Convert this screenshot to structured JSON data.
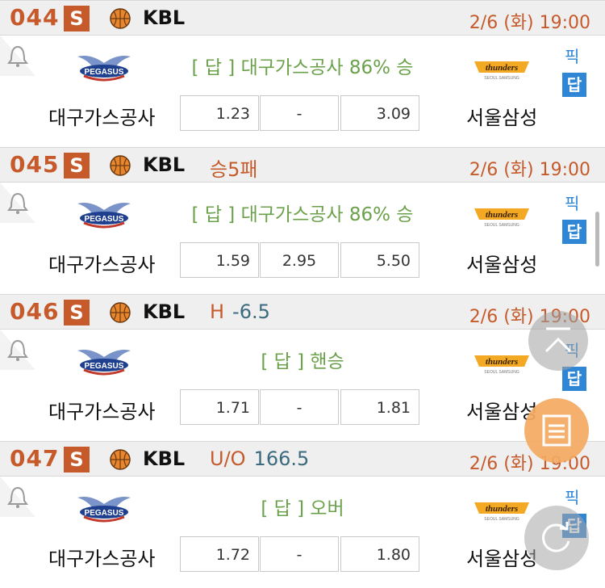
{
  "games": [
    {
      "number": "044",
      "badge": "S",
      "league": "KBL",
      "extra_key": "",
      "extra_value": "",
      "extra_style": "",
      "date": "2/6 (화)  19:00",
      "answer": "[ 답 ]  대구가스공사 86% 승",
      "home_team": "대구가스공사",
      "away_team": "서울삼성",
      "odds": [
        "1.23",
        "-",
        "3.09"
      ],
      "pick_label": "픽",
      "answer_badge": "답"
    },
    {
      "number": "045",
      "badge": "S",
      "league": "KBL",
      "extra_key": "승5패",
      "extra_value": "",
      "extra_style": "",
      "date": "2/6 (화)  19:00",
      "answer": "[ 답 ]  대구가스공사 86% 승",
      "home_team": "대구가스공사",
      "away_team": "서울삼성",
      "odds": [
        "1.59",
        "2.95",
        "5.50"
      ],
      "pick_label": "픽",
      "answer_badge": "답"
    },
    {
      "number": "046",
      "badge": "S",
      "league": "KBL",
      "extra_key": "H",
      "extra_value": "-6.5",
      "extra_style": "",
      "date": "2/6 (화)  19:00",
      "answer": "[ 답 ] 핸승",
      "home_team": "대구가스공사",
      "away_team": "서울삼성",
      "odds": [
        "1.71",
        "-",
        "1.81"
      ],
      "pick_label": "픽",
      "answer_badge": "답"
    },
    {
      "number": "047",
      "badge": "S",
      "league": "KBL",
      "extra_key": "U/O",
      "extra_value": "166.5",
      "extra_style": "",
      "date": "2/6 (화)  19:00",
      "answer": "[ 답 ] 오버",
      "home_team": "대구가스공사",
      "away_team": "서울삼성",
      "odds": [
        "1.72",
        "-",
        "1.80"
      ],
      "pick_label": "픽",
      "answer_badge": "답"
    }
  ],
  "colors": {
    "accent": "#c65a2b",
    "answer_text": "#6aa14a",
    "pick_blue": "#2f86d4",
    "header_bg": "#efefef",
    "value_blue": "#3c6a7e",
    "fab_orange": "#f3a95f"
  },
  "icons": {
    "bell": "bell-icon",
    "ball": "basketball-icon",
    "scroll_top": "scroll-to-top-icon",
    "menu": "list-menu-icon",
    "refresh": "refresh-icon"
  }
}
